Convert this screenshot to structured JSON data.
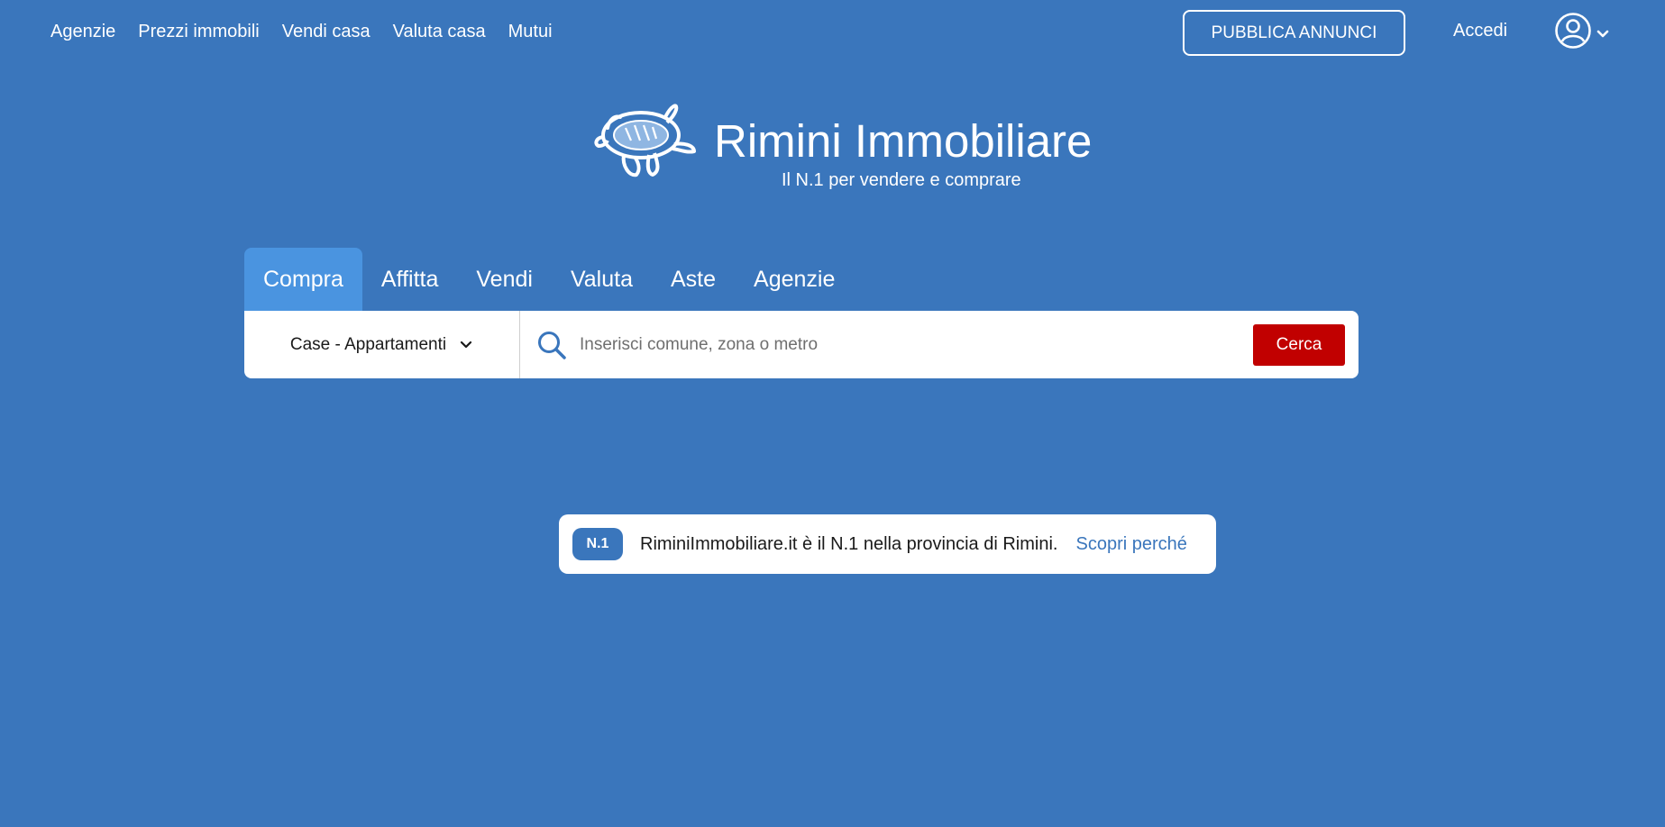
{
  "topnav": {
    "items": [
      "Agenzie",
      "Prezzi immobili",
      "Vendi casa",
      "Valuta casa",
      "Mutui"
    ]
  },
  "header": {
    "publish_label": "PUBBLICA ANNUNCI",
    "login_label": "Accedi"
  },
  "brand": {
    "title": "Rimini Immobiliare",
    "subtitle": "Il N.1 per vendere e comprare"
  },
  "search": {
    "tabs": [
      "Compra",
      "Affitta",
      "Vendi",
      "Valuta",
      "Aste",
      "Agenzie"
    ],
    "active_tab": "Compra",
    "type_value": "Case - Appartamenti",
    "placeholder": "Inserisci comune, zona o metro",
    "button_label": "Cerca"
  },
  "banner": {
    "badge": "N.1",
    "text": "RiminiImmobiliare.it è il N.1 nella provincia di Rimini.",
    "link": "Scopri perché"
  },
  "colors": {
    "background": "#3a76bc",
    "active_tab": "#4a94e0",
    "search_button": "#c10000"
  },
  "icons": [
    "turtle-logo-icon",
    "user-circle-icon",
    "chevron-down-icon",
    "search-icon"
  ]
}
